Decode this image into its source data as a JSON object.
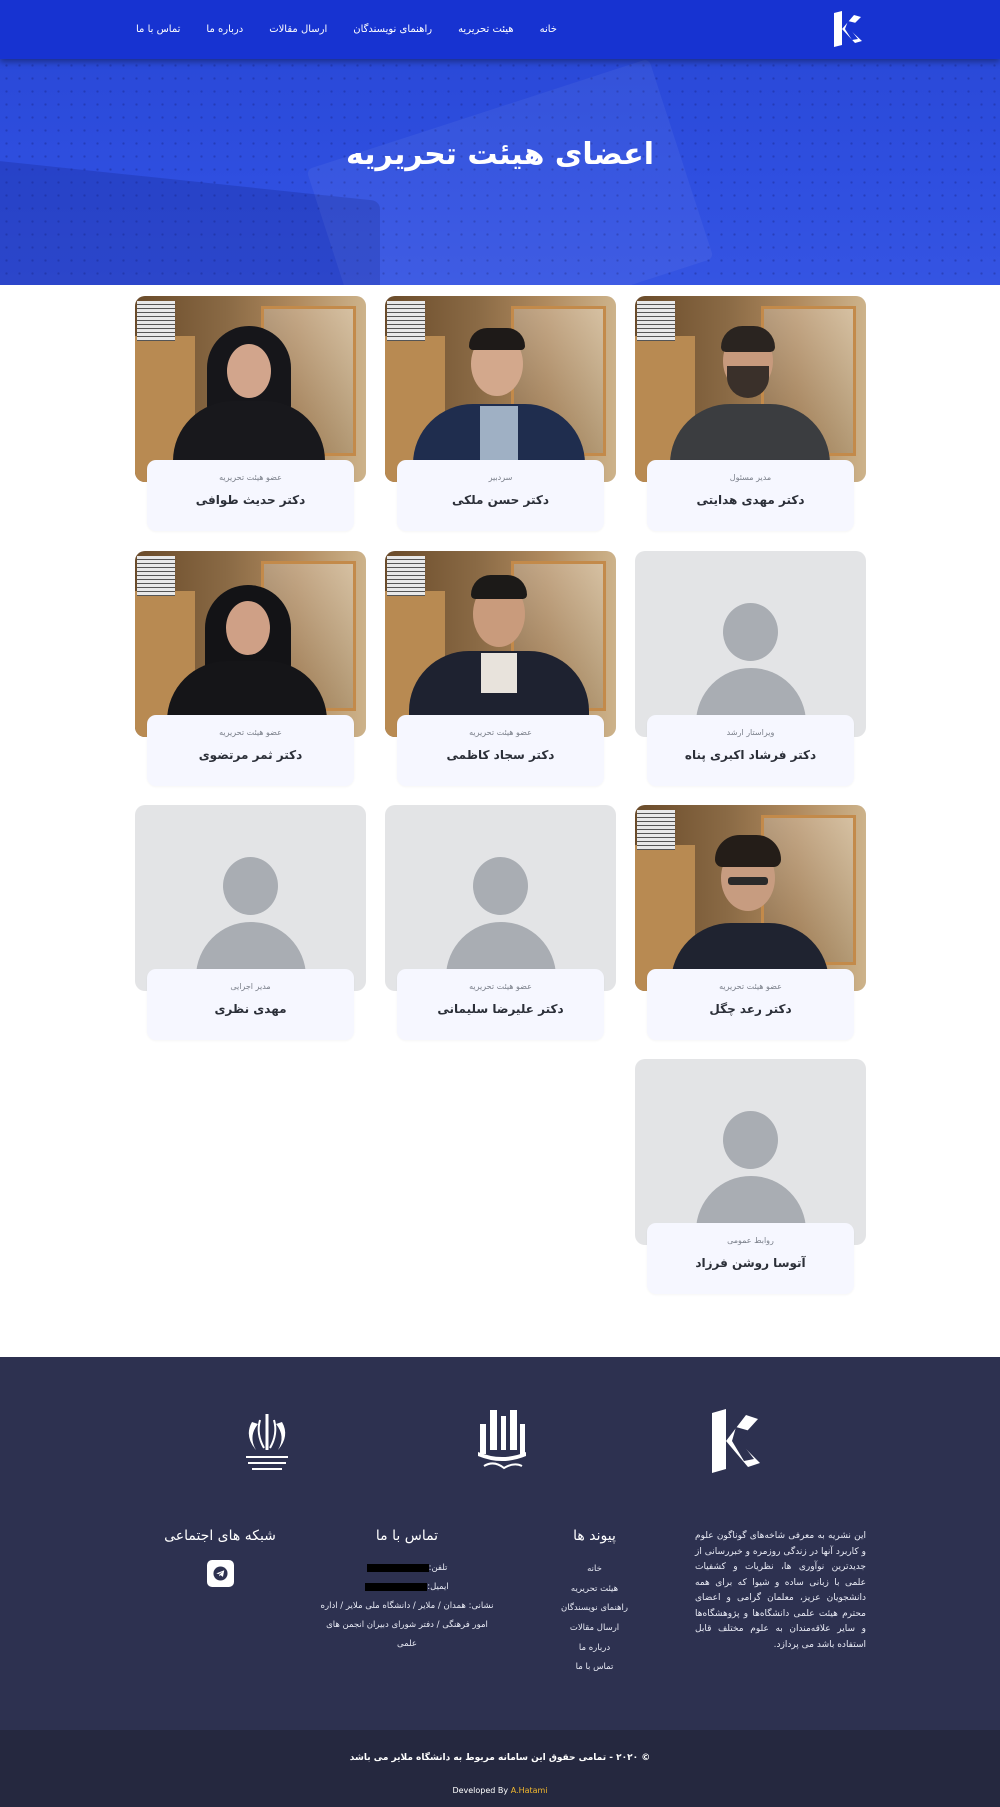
{
  "nav": {
    "items": [
      {
        "label": "خانه"
      },
      {
        "label": "هیئت تحریریه"
      },
      {
        "label": "راهنمای نویسندگان"
      },
      {
        "label": "ارسال مقالات"
      },
      {
        "label": "درباره ما"
      },
      {
        "label": "تماس با ما"
      }
    ]
  },
  "hero": {
    "title": "اعضای هیئت تحریریه"
  },
  "members": [
    {
      "role": "مدیر مسئول",
      "name": "دکتر مهدی هدایتی",
      "photo": "man-beard"
    },
    {
      "role": "سردبیر",
      "name": "دکتر حسن ملکی",
      "photo": "man-suit"
    },
    {
      "role": "عضو هیئت تحریریه",
      "name": "دکتر حدیث طوافی",
      "photo": "woman-hijab"
    },
    {
      "role": "ویراستار ارشد",
      "name": "دکتر فرشاد اکبری پناه",
      "photo": "placeholder"
    },
    {
      "role": "عضو هیئت تحریریه",
      "name": "دکتر سجاد کاظمی",
      "photo": "man-jacket"
    },
    {
      "role": "عضو هیئت تحریریه",
      "name": "دکتر ثمر مرتضوی",
      "photo": "woman-hijab"
    },
    {
      "role": "عضو هیئت تحریریه",
      "name": "دکتر رعد چگل",
      "photo": "man-glasses"
    },
    {
      "role": "عضو هیئت تحریریه",
      "name": "دکتر علیرضا سلیمانی",
      "photo": "placeholder"
    },
    {
      "role": "مدیر اجرایی",
      "name": "مهدی نظری",
      "photo": "placeholder"
    },
    {
      "role": "روابط عمومی",
      "name": "آتوسا روشن فرزاد",
      "photo": "placeholder"
    }
  ],
  "footer": {
    "about": "این نشریه به معرفی شاخه‌های گوناگون علوم و کاربرد آنها در زندگی روزمره و خبررسانی از جدیدترین نوآوری ها، نظریات و کشفیات علمی با زبانی ساده و شیوا که برای همه دانشجویان عزیز، معلمان گرامی و اعضای محترم هیئت علمی دانشگاه‌ها و پژوهشگاه‌ها و سایر علاقه‌مندان به علوم مختلف قابل استفاده باشد می پردازد.",
    "links_title": "پیوند ها",
    "links": [
      "خانه",
      "هیئت تحریریه",
      "راهنمای نویسندگان",
      "ارسال مقالات",
      "درباره ما",
      "تماس با ما"
    ],
    "contact_title": "تماس با ما",
    "phone_label": "تلفن:",
    "email_label": "ایمیل:",
    "address": "نشانی: همدان / ملایر / دانشگاه ملی ملایر / اداره امور فرهنگی / دفتر شورای دبیران انجمن های علمی",
    "social_title": "شبکه های اجتماعی",
    "social_icon": "telegram-icon",
    "copyright": "© ۲۰۲۰ - تمامی حقوق این سامانه مربوط به دانشگاه ملایر می باشد",
    "dev_prefix": "Developed By",
    "dev_name": "A.Hatami"
  },
  "colors": {
    "nav": "#1733d1",
    "hero": "#2f4fe0",
    "footer": "#2d3150",
    "footer_bottom": "#25283f",
    "card_info": "#f6f7ff",
    "accent_dev": "#f2b82e"
  }
}
